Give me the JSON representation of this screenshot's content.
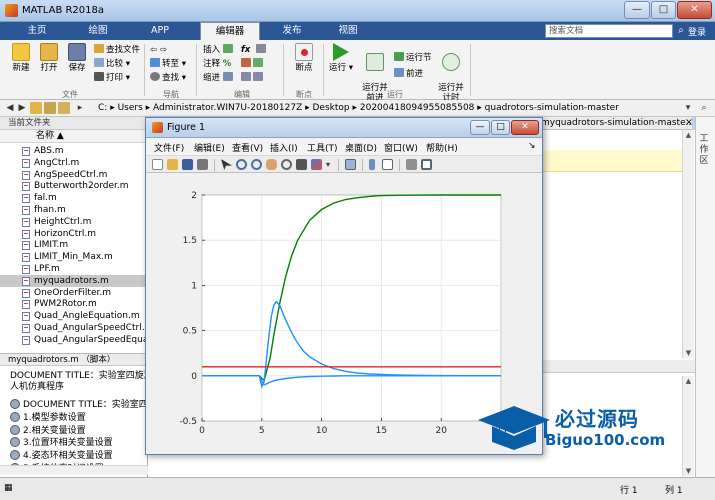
{
  "window": {
    "title": "MATLAB R2018a",
    "min": "—",
    "max": "□",
    "close": "✕"
  },
  "tabs": [
    {
      "label": "主页",
      "active": false
    },
    {
      "label": "绘图",
      "active": false
    },
    {
      "label": "APP",
      "active": false
    },
    {
      "label": "编辑器",
      "active": true
    },
    {
      "label": "发布",
      "active": false
    },
    {
      "label": "视图",
      "active": false
    }
  ],
  "search": {
    "placeholder": "搜索文档"
  },
  "login": "登录",
  "ribbon": {
    "file": {
      "new": "新建",
      "open": "打开",
      "save": "保存",
      "find_files": "查找文件",
      "compare": "比较",
      "print": "打印",
      "group": "文件"
    },
    "navigate": {
      "goto": "转至",
      "find": "查找",
      "group": "导航"
    },
    "edit": {
      "insert": "插入",
      "comment": "注释",
      "indent": "缩进",
      "fx": "fx",
      "group": "编辑"
    },
    "breakpoints": {
      "label": "断点",
      "group": "断点"
    },
    "run": {
      "run": "运行",
      "run_advance": "运行并\n前进",
      "run_section": "运行节",
      "advance": "前进",
      "run_time": "运行并\n计时",
      "group": "运行"
    }
  },
  "address": {
    "segments": [
      "C:",
      "Users",
      "Administrator.WIN7U-20180127Z",
      "Desktop",
      "20200418094955085508",
      "quadrotors-simulation-master"
    ]
  },
  "left_panel": {
    "header": "当前文件夹",
    "column": "名称",
    "files": [
      "ABS.m",
      "AngCtrl.m",
      "AngSpeedCtrl.m",
      "Butterworth2order.m",
      "fal.m",
      "fhan.m",
      "HeightCtrl.m",
      "HorizonCtrl.m",
      "LIMIT.m",
      "LIMIT_Min_Max.m",
      "LPF.m",
      "myquadrotors.m",
      "OneOrderFilter.m",
      "PWM2Rotor.m",
      "Quad_AngleEquation.m",
      "Quad_AngularSpeedCtrl.m",
      "Quad_AngularSpeedEquatio"
    ],
    "selected": "myquadrotors.m",
    "details_title": "myquadrotors.m （脚本）",
    "doc_line1": "DOCUMENT TITLE：实验室四旋翼",
    "doc_line2": "人机仿真程序",
    "cells": [
      "DOCUMENT TITLE：实验室四旋",
      "1.模型参数设置",
      "2.相关变量设置",
      "3.位置环相关变量设置",
      "4.姿态环相关变量设置",
      "5.系统仿真时间设置"
    ]
  },
  "editor": {
    "tab": "myquadrotors-simulation-maste...",
    "close": "×"
  },
  "right_label": "工作区",
  "status": {
    "row_label": "行",
    "row_value": "1",
    "col_label": "列",
    "col_value": "1"
  },
  "figure": {
    "title": "Figure 1",
    "menu": [
      "文件(F)",
      "编辑(E)",
      "查看(V)",
      "插入(I)",
      "工具(T)",
      "桌面(D)",
      "窗口(W)",
      "帮助(H)"
    ]
  },
  "chart_data": {
    "type": "line",
    "title": "",
    "xlabel": "",
    "ylabel": "",
    "xlim": [
      0,
      25
    ],
    "ylim": [
      -0.5,
      2
    ],
    "xticks": [
      0,
      5,
      10,
      15,
      20,
      25
    ],
    "yticks": [
      -0.5,
      0,
      0.5,
      1,
      1.5,
      2
    ],
    "grid": true,
    "series": [
      {
        "color": "#008000",
        "x": [
          0,
          4.8,
          5.0,
          5.2,
          5.4,
          5.7,
          6.0,
          6.5,
          7.0,
          7.5,
          8.0,
          9.0,
          10.0,
          11.0,
          12.0,
          13.0,
          14.0,
          15.0,
          17.0,
          20.0,
          25.0
        ],
        "y": [
          0,
          0,
          -0.03,
          -0.05,
          0.05,
          0.2,
          0.45,
          0.8,
          1.1,
          1.33,
          1.5,
          1.72,
          1.84,
          1.91,
          1.95,
          1.97,
          1.985,
          1.993,
          1.998,
          2.0,
          2.0
        ]
      },
      {
        "color": "#1e90ff",
        "x": [
          0,
          4.8,
          5.0,
          5.2,
          5.4,
          5.6,
          5.8,
          6.0,
          6.2,
          6.5,
          6.8,
          7.2,
          7.6,
          8.0,
          8.5,
          9.0,
          10.0,
          11.0,
          12.0,
          13.0,
          14.0,
          16.0,
          18.0,
          20.0,
          25.0
        ],
        "y": [
          0,
          0,
          -0.12,
          -0.06,
          0.2,
          0.45,
          0.66,
          0.78,
          0.82,
          0.78,
          0.68,
          0.56,
          0.45,
          0.36,
          0.27,
          0.21,
          0.13,
          0.08,
          0.05,
          0.03,
          0.02,
          0.01,
          0.005,
          0.002,
          0.0
        ]
      },
      {
        "color": "#1e90ff",
        "x": [
          0,
          4.8,
          5.0,
          5.2,
          5.4,
          5.7,
          6.0,
          6.5,
          7.0,
          8.0,
          9.0,
          10.0,
          11.0,
          12.0,
          14.0,
          16.0,
          20.0,
          25.0
        ],
        "y": [
          0,
          0,
          -0.06,
          -0.1,
          -0.09,
          -0.07,
          -0.055,
          -0.04,
          -0.03,
          -0.015,
          -0.008,
          -0.004,
          -0.002,
          0.0,
          0.0,
          0.0,
          0.0,
          0.0
        ]
      },
      {
        "color": "#e02020",
        "x": [
          0,
          25
        ],
        "y": [
          0.1,
          0.1
        ]
      }
    ]
  },
  "watermark": {
    "cn": "必过源码",
    "url": "Biguo100.com"
  }
}
